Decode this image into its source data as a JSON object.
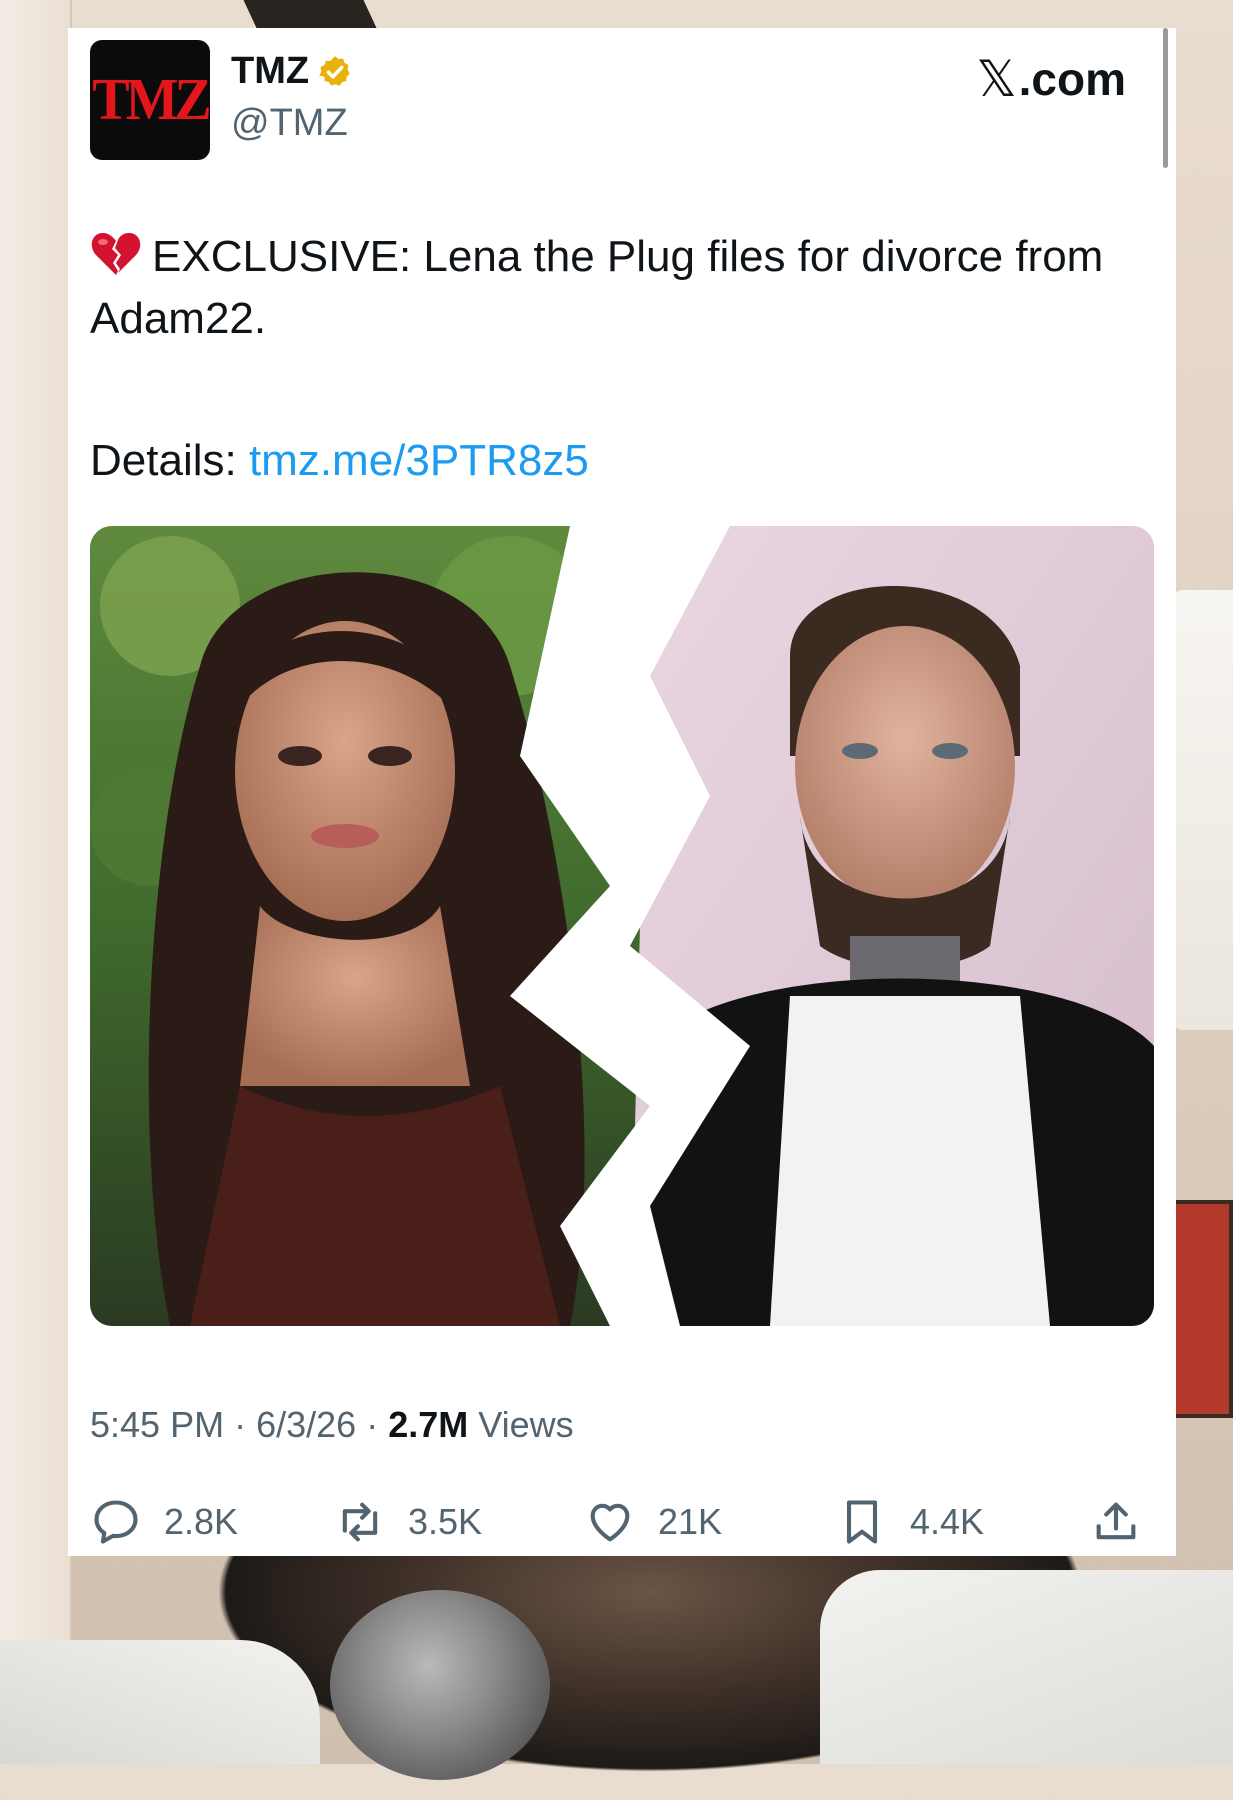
{
  "post": {
    "author_name": "TMZ",
    "author_handle": "@TMZ",
    "avatar_text": "TMZ",
    "site_label": "X.com",
    "site_x": "𝕏",
    "site_rest": ".com",
    "text_line": "EXCLUSIVE: Lena the Plug files for divorce from Adam22.",
    "details_label": "Details:",
    "details_link": "tmz.me/3PTR8z5",
    "time": "5:45 PM",
    "date": "6/3/26",
    "views_count": "2.7M",
    "views_label": "Views",
    "sep": "·"
  },
  "actions": {
    "replies": "2.8K",
    "reposts": "3.5K",
    "likes": "21K",
    "bookmarks": "4.4K"
  },
  "colors": {
    "link": "#1d9bf0",
    "verified_badge": "#e8b10b",
    "tmz_red": "#e3161b",
    "muted_text": "#536471"
  },
  "icons": [
    "broken-heart-icon",
    "verified-badge-icon",
    "reply-icon",
    "repost-icon",
    "like-icon",
    "bookmark-icon",
    "share-icon"
  ]
}
